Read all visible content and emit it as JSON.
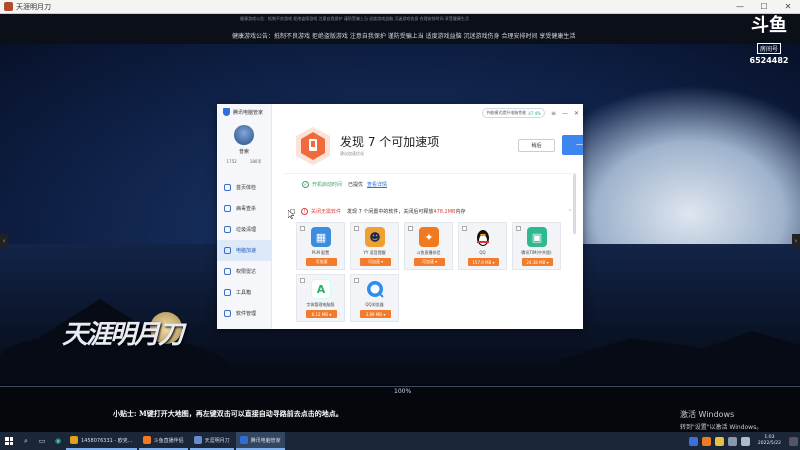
{
  "game_window": {
    "title": "天涯明月刀",
    "announcement_small": "健康游戏公告：抵制不良游戏 拒绝盗版游戏 注意自我保护 谨防受骗上当 适度游戏益脑 沉迷游戏伤身 合理安排时间 享受健康生活",
    "announcement": "健康游戏公告：抵制不良游戏 拒绝盗版游戏 注意自我保护 谨防受骗上当 适度游戏益脑 沉迷游戏伤身 合理安排时间 享受健康生活",
    "logo_text": "天涯明月刀",
    "loading_progress": "100%",
    "tip": "小贴士: M键打开大地图，再左键双击可以直接自动寻路前去点击的地点。"
  },
  "watermark": {
    "logo": "斗鱼",
    "room_label": "房间号",
    "room_number": "6524482"
  },
  "activation": {
    "line1": "激活 Windows",
    "line2": "转到\"设置\"以激活 Windows。"
  },
  "optimizer": {
    "brand": "腾讯电脑管家",
    "user_name": "普索",
    "user_meta": [
      "1752",
      "180币"
    ],
    "nav": [
      {
        "label": "首页体检",
        "icon": "home-icon"
      },
      {
        "label": "病毒查杀",
        "icon": "virus-scan-icon"
      },
      {
        "label": "垃圾清理",
        "icon": "trash-icon"
      },
      {
        "label": "电脑加速",
        "icon": "rocket-icon"
      },
      {
        "label": "权限雷达",
        "icon": "radar-icon"
      },
      {
        "label": "工具箱",
        "icon": "toolbox-icon"
      },
      {
        "label": "软件管理",
        "icon": "software-icon"
      }
    ],
    "mode_label": "节能模式提升电脑性能",
    "mode_percent": "47.4%",
    "heading": "发现 7 个可加速项",
    "subheading": "建议加速优化",
    "btn_later": "稍后",
    "btn_boost": "一键加速",
    "row1": {
      "label": "开机启动时间",
      "value": "已提优",
      "link": "查看详情"
    },
    "row2": {
      "label": "关闭无需软件",
      "desc": "发现 7 个闲置中的软件，关闭后可释放 ",
      "size": "478.2MB",
      "suffix": " 内存"
    },
    "apps": [
      {
        "name": "PLM 配置",
        "size": "可加速",
        "icon_color": "#3c8de0",
        "glyph": "▦"
      },
      {
        "name": "YY 语音提醒",
        "size": "可加速 ▾",
        "icon_color": "#f0a030",
        "glyph": "☻"
      },
      {
        "name": "斗鱼直播伴侣",
        "size": "可加速 ▾",
        "icon_color": "#f07a20",
        "glyph": "✦"
      },
      {
        "name": "QQ",
        "size": "157.9 MB ▾",
        "icon_color": "#ffffff",
        "glyph": "🐧"
      },
      {
        "name": "腾讯TIM(中共版)",
        "size": "24.38 MB ▾",
        "icon_color": "#30b890",
        "glyph": "▣"
      },
      {
        "name": "字体管理电脑版",
        "size": "6.12 MB ▾",
        "icon_color": "#ffffff",
        "glyph": "A"
      },
      {
        "name": "QQ浏览器",
        "size": "3.89 MB ▾",
        "icon_color": "#ffffff",
        "glyph": "◐"
      }
    ]
  },
  "taskbar": {
    "tasks": [
      {
        "label": "1458076331 - 欧克...",
        "color": "#e0a020"
      },
      {
        "label": "斗鱼直播伴侣",
        "color": "#f07a20"
      },
      {
        "label": "天涯明月刀",
        "color": "#6a8ad0"
      },
      {
        "label": "腾讯电脑管家",
        "color": "#2f6fd6"
      }
    ],
    "time": "1:03",
    "date": "2022/5/22"
  }
}
